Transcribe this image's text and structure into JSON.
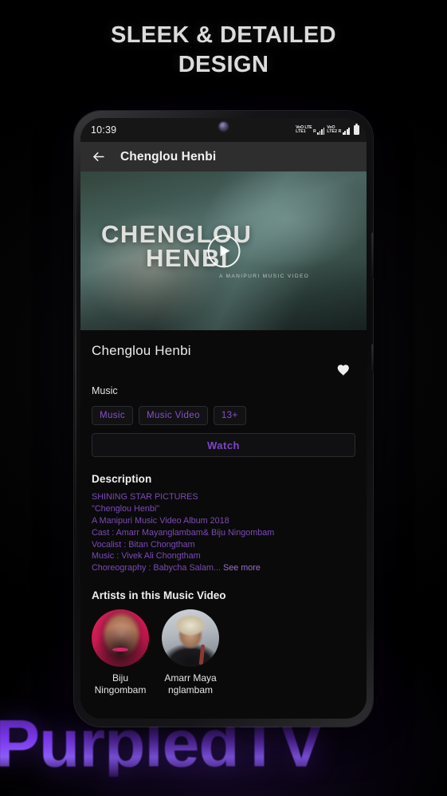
{
  "promo": {
    "headline_line1": "SLEEK & DETAILED",
    "headline_line2": "DESIGN",
    "watermark": "PurpledTV"
  },
  "statusbar": {
    "time": "10:39",
    "sim1_line1": "VoO LTE",
    "sim1_line2": "LTE1",
    "sim1_roam": "R",
    "sim2_line1": "VoO",
    "sim2_line2": "LTE2",
    "sim2_roam": "R",
    "battery_icon": "battery-icon",
    "camera_icon": "front-camera-icon"
  },
  "appbar": {
    "back_icon": "back-arrow-icon",
    "title": "Chenglou Henbi"
  },
  "hero": {
    "overlay_line1": "CHENGLOU",
    "overlay_line2": "HENBI",
    "overlay_sub": "A MANIPURI MUSIC VIDEO",
    "play_icon": "play-icon"
  },
  "detail": {
    "title": "Chenglou Henbi",
    "favorite_icon": "heart-icon",
    "category": "Music",
    "chips": [
      "Music",
      "Music Video",
      "13+"
    ],
    "watch_label": "Watch"
  },
  "description": {
    "heading": "Description",
    "lines": [
      "SHINING STAR PICTURES",
      "\"Chenglou Henbi\"",
      "A Manipuri Music Video Album 2018",
      "Cast : Amarr Mayanglambam& Biju Ningombam",
      "Vocalist : Bitan Chongtham",
      "Music : Vivek Ali Chongtham",
      "Choreography : Babycha Salam..."
    ],
    "see_more": "See more"
  },
  "artists": {
    "heading": "Artists in this Music Video",
    "items": [
      {
        "name_line1": "Biju",
        "name_line2": "Ningombam",
        "avatar": "artist-avatar-biju"
      },
      {
        "name_line1": "Amarr Maya",
        "name_line2": "nglambam",
        "avatar": "artist-avatar-amarr"
      }
    ]
  },
  "colors": {
    "accent_purple": "#7b4ab8",
    "watch_purple": "#7d46c4",
    "chip_purple": "#8a4fc7",
    "appbar_bg": "#2e2e2e",
    "screen_bg": "#0a0a0a"
  }
}
